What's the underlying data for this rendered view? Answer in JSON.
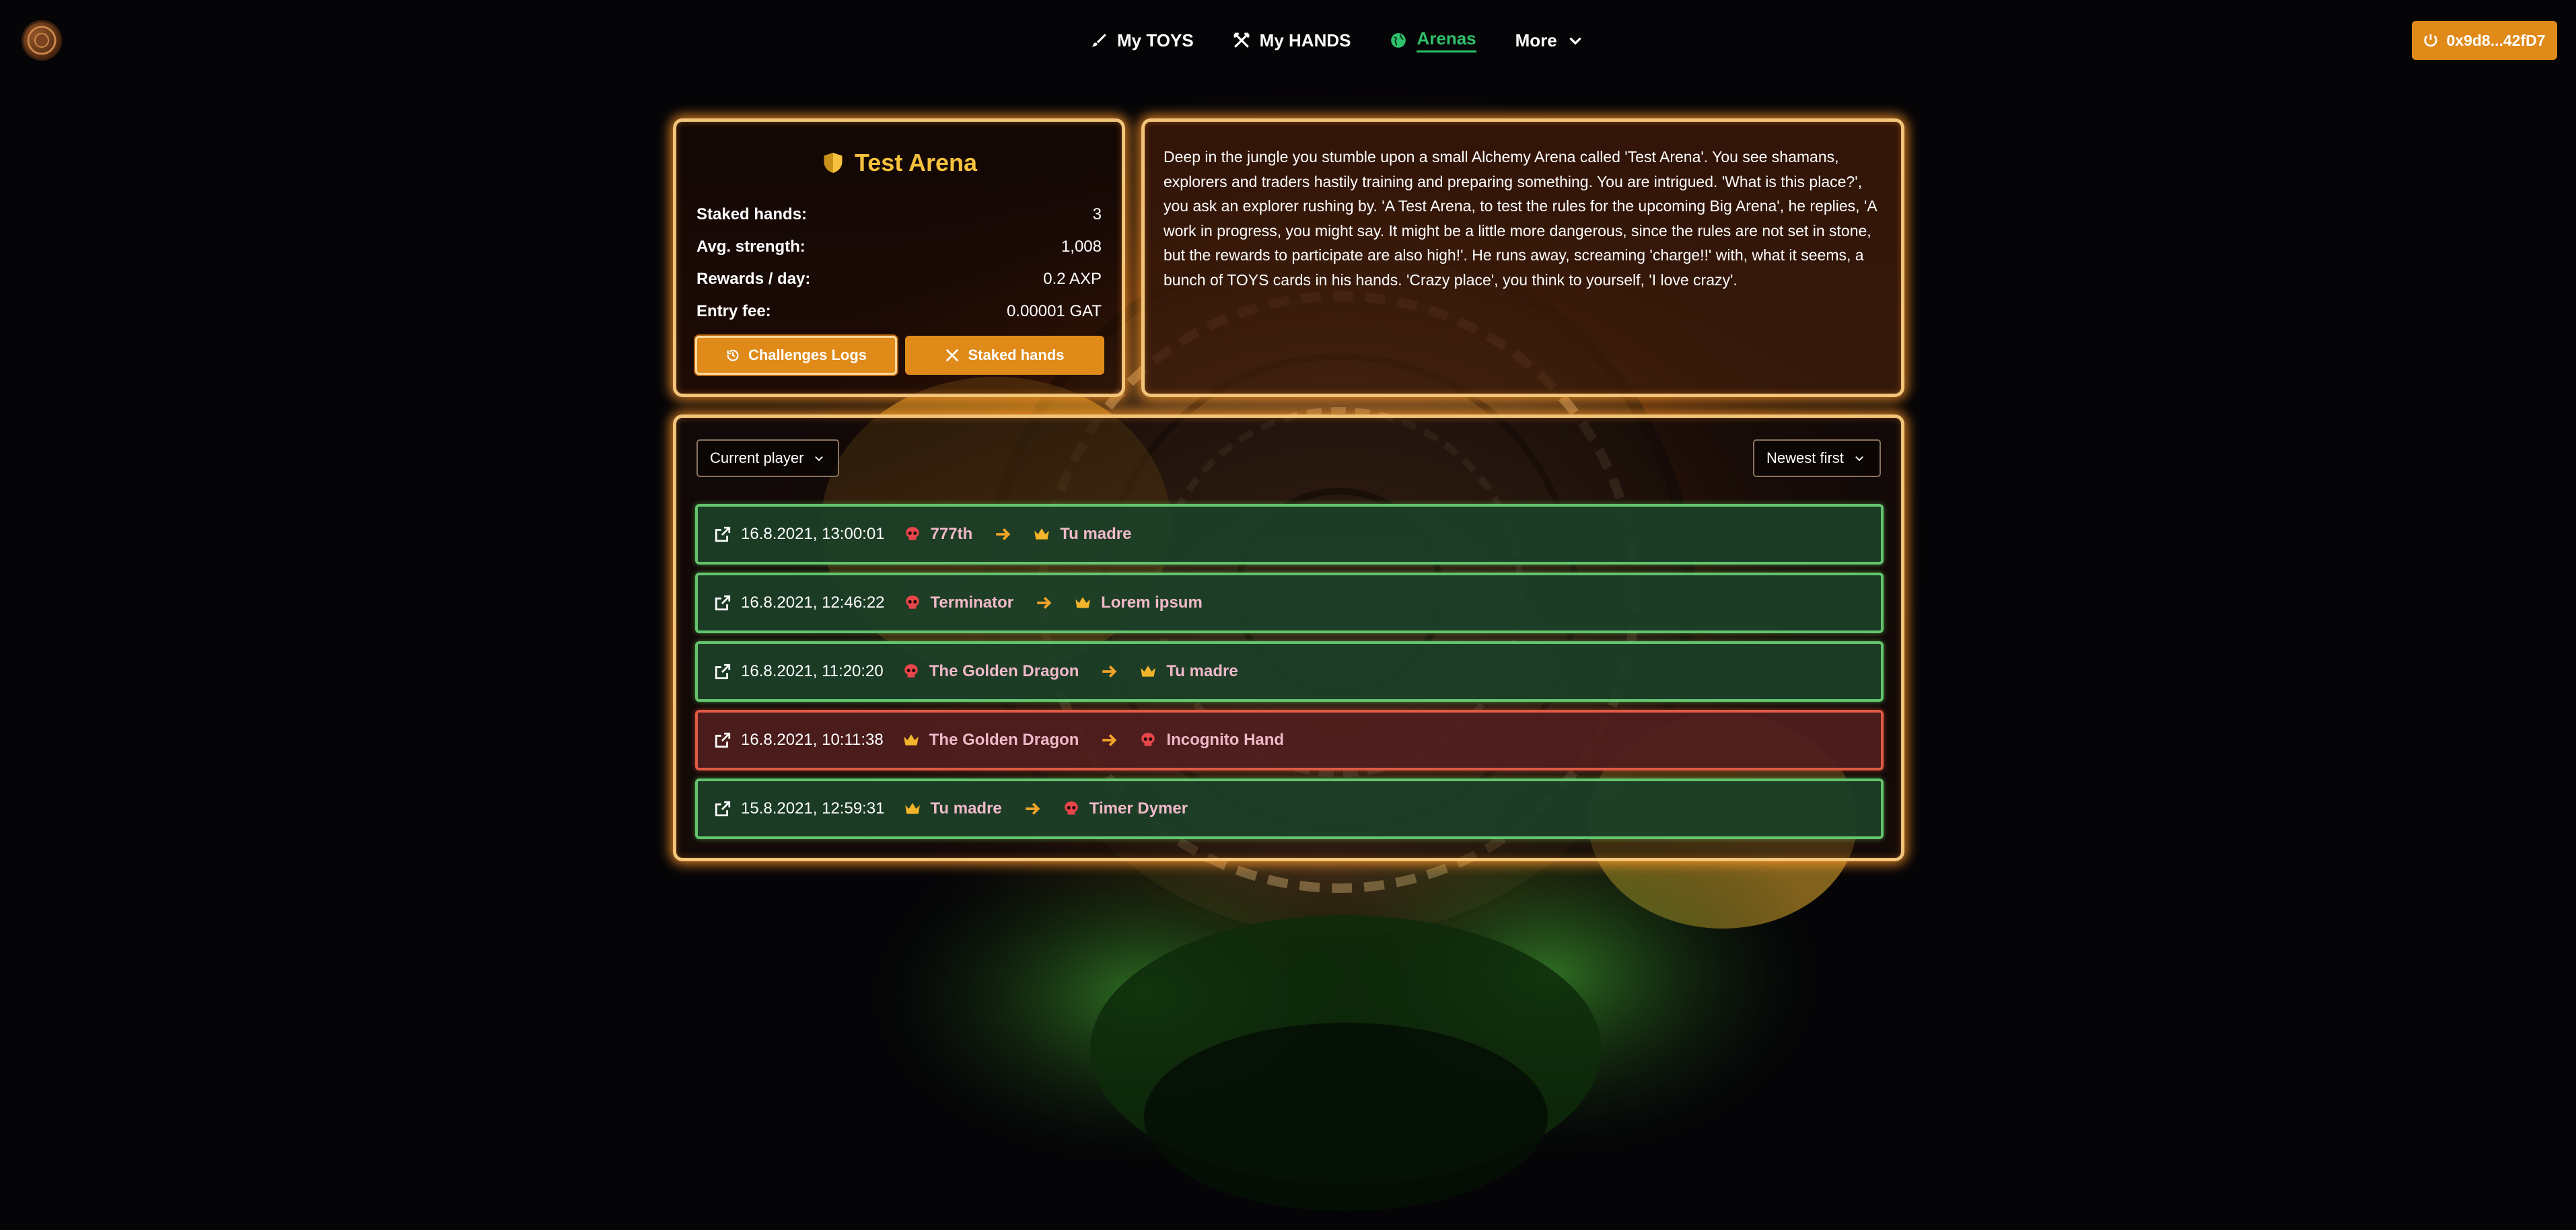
{
  "header": {
    "nav": [
      {
        "label": "My TOYS",
        "icon": "brush-icon",
        "active": false
      },
      {
        "label": "My HANDS",
        "icon": "crossed-swords-icon",
        "active": false
      },
      {
        "label": "Arenas",
        "icon": "globe-icon",
        "active": true
      },
      {
        "label": "More",
        "icon": "chevron-down-icon",
        "active": false
      }
    ],
    "wallet": "0x9d8...42fD7"
  },
  "arena": {
    "title": "Test Arena",
    "stats": [
      {
        "label": "Staked hands:",
        "value": "3"
      },
      {
        "label": "Avg. strength:",
        "value": "1,008"
      },
      {
        "label": "Rewards / day:",
        "value": "0.2 AXP"
      },
      {
        "label": "Entry fee:",
        "value": "0.00001 GAT"
      }
    ],
    "buttons": {
      "logs": "Challenges Logs",
      "staked": "Staked hands"
    },
    "description": "Deep in the jungle you stumble upon a small Alchemy Arena called 'Test Arena'. You see shamans, explorers and traders hastily training and preparing something. You are intrigued. 'What is this place?', you ask an explorer rushing by. 'A Test Arena, to test the rules for the upcoming Big Arena', he replies, 'A work in progress, you might say. It might be a little more dangerous, since the rules are not set in stone, but the rewards to participate are also high!'. He runs away, screaming 'charge!!' with, what it seems, a bunch of TOYS cards in his hands. 'Crazy place', you think to yourself, 'I love crazy'."
  },
  "logs": {
    "filter": "Current player",
    "sort": "Newest first",
    "rows": [
      {
        "time": "16.8.2021, 13:00:01",
        "challenger": "777th",
        "challenger_icon": "skull-icon",
        "defender": "Tu madre",
        "defender_icon": "crown-icon",
        "result": "win"
      },
      {
        "time": "16.8.2021, 12:46:22",
        "challenger": "Terminator",
        "challenger_icon": "skull-icon",
        "defender": "Lorem ipsum",
        "defender_icon": "crown-icon",
        "result": "win"
      },
      {
        "time": "16.8.2021, 11:20:20",
        "challenger": "The Golden Dragon",
        "challenger_icon": "skull-icon",
        "defender": "Tu madre",
        "defender_icon": "crown-icon",
        "result": "win"
      },
      {
        "time": "16.8.2021, 10:11:38",
        "challenger": "The Golden Dragon",
        "challenger_icon": "crown-icon",
        "defender": "Incognito Hand",
        "defender_icon": "skull-icon",
        "result": "loss"
      },
      {
        "time": "15.8.2021, 12:59:31",
        "challenger": "Tu madre",
        "challenger_icon": "crown-icon",
        "defender": "Timer Dymer",
        "defender_icon": "skull-icon",
        "result": "win"
      }
    ]
  },
  "colors": {
    "accent": "#e08a1a",
    "active_nav": "#2ec26b",
    "title_gold": "#f6c13c",
    "win_border": "#63c46e",
    "loss_border": "#e05a44",
    "player_name": "#f0b9c9"
  }
}
